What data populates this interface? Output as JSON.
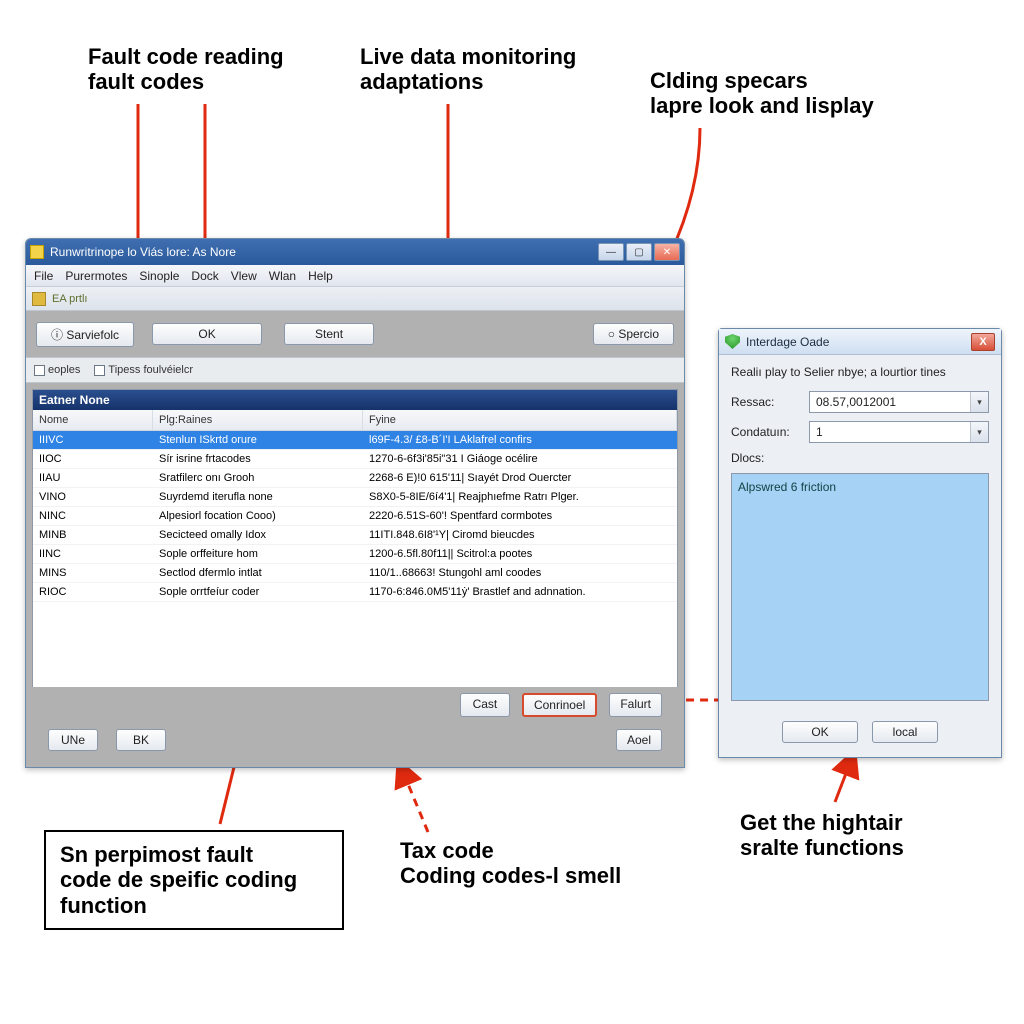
{
  "annotations": {
    "top_left": "Fault code reading\nfault codes",
    "top_mid": "Live data monitoring\nadaptations",
    "top_right": "Clding specars\nlapre look and lisplay",
    "bottom_left_box": "Sn perpimost fault\ncode de speific coding\nfunction",
    "bottom_mid": "Tax code\nCoding codes-l smell",
    "bottom_right": "Get the hightair\nsralte functions"
  },
  "main_window": {
    "title": "Runwritrinope lo Viás lore: As Nore",
    "menu": [
      "File",
      "Purermotes",
      "Sinople",
      "Dock",
      "Vlew",
      "Wlan",
      "Help"
    ],
    "toolbar_tab": "EA prtlı",
    "btn_savefoc": "Sarviefolc",
    "btn_ok": "OK",
    "btn_stent": "Stent",
    "btn_spercio": "Spercio",
    "check1": "eoples",
    "check2": "Tipess foulvéielcr",
    "panel_title": "Eatner None",
    "columns": {
      "name": "Nome",
      "plg": "Plg:Raines",
      "fyne": "Fyine"
    },
    "rows": [
      {
        "n": "IIIVC",
        "p": "Stenlun ISkrtd orure",
        "f": "l69F-4.3/ £8-B´I'I LAklafrel confirs"
      },
      {
        "n": "IIOC",
        "p": "Sír isrine frtacodes",
        "f": "1270-6-6f3i'85i\"31 I Giáoge océlire"
      },
      {
        "n": "IIAU",
        "p": "Sratfilerc onı Grooh",
        "f": "2268-6 E)!0 615'11| Sıayét Drod Ouercter"
      },
      {
        "n": "VINO",
        "p": "Suyrdemd iterufla none",
        "f": "S8X0-5-8IE/6í4'1| Reajphıefme Ratrı Plger."
      },
      {
        "n": "NINC",
        "p": "Alpesiorl focation Cooo)",
        "f": "2220-6.51S-60'! Spentfard cormbotes"
      },
      {
        "n": "MINB",
        "p": "Secicteed omally Idox",
        "f": "11ITI.848.6I8'¹Y| Ciromd bieucdes"
      },
      {
        "n": "IINC",
        "p": "Sople orffeiture hom",
        "f": "1200-6.5fl.80f11|| Scitrol:a pootes"
      },
      {
        "n": "MINS",
        "p": "Sectlod dfermlo intlat",
        "f": "110/1..68663! Stungohl aml coodes"
      },
      {
        "n": "RIOC",
        "p": "Sople orrtfeíur coder",
        "f": "1170-6:846.0M5'11ẏ' Brastlef and adnnation."
      }
    ],
    "btn_cast": "Cast",
    "btn_conrinoel": "Conrinoel",
    "btn_falurt": "Falurt",
    "btn_une": "UNe",
    "btn_bk": "BK",
    "btn_aoel": "Aoel"
  },
  "dialog": {
    "title": "Interdage Oade",
    "message": "Realiı play to Selier nbye; a lourtior tines",
    "ressac_label": "Ressac:",
    "ressac_value": "08.57,0012001",
    "cond_label": "Condatuın:",
    "cond_value": "1",
    "dlocs_label": "Dlocs:",
    "list_item": "Alpswred 6 friction",
    "btn_ok": "OK",
    "btn_local": "local"
  }
}
